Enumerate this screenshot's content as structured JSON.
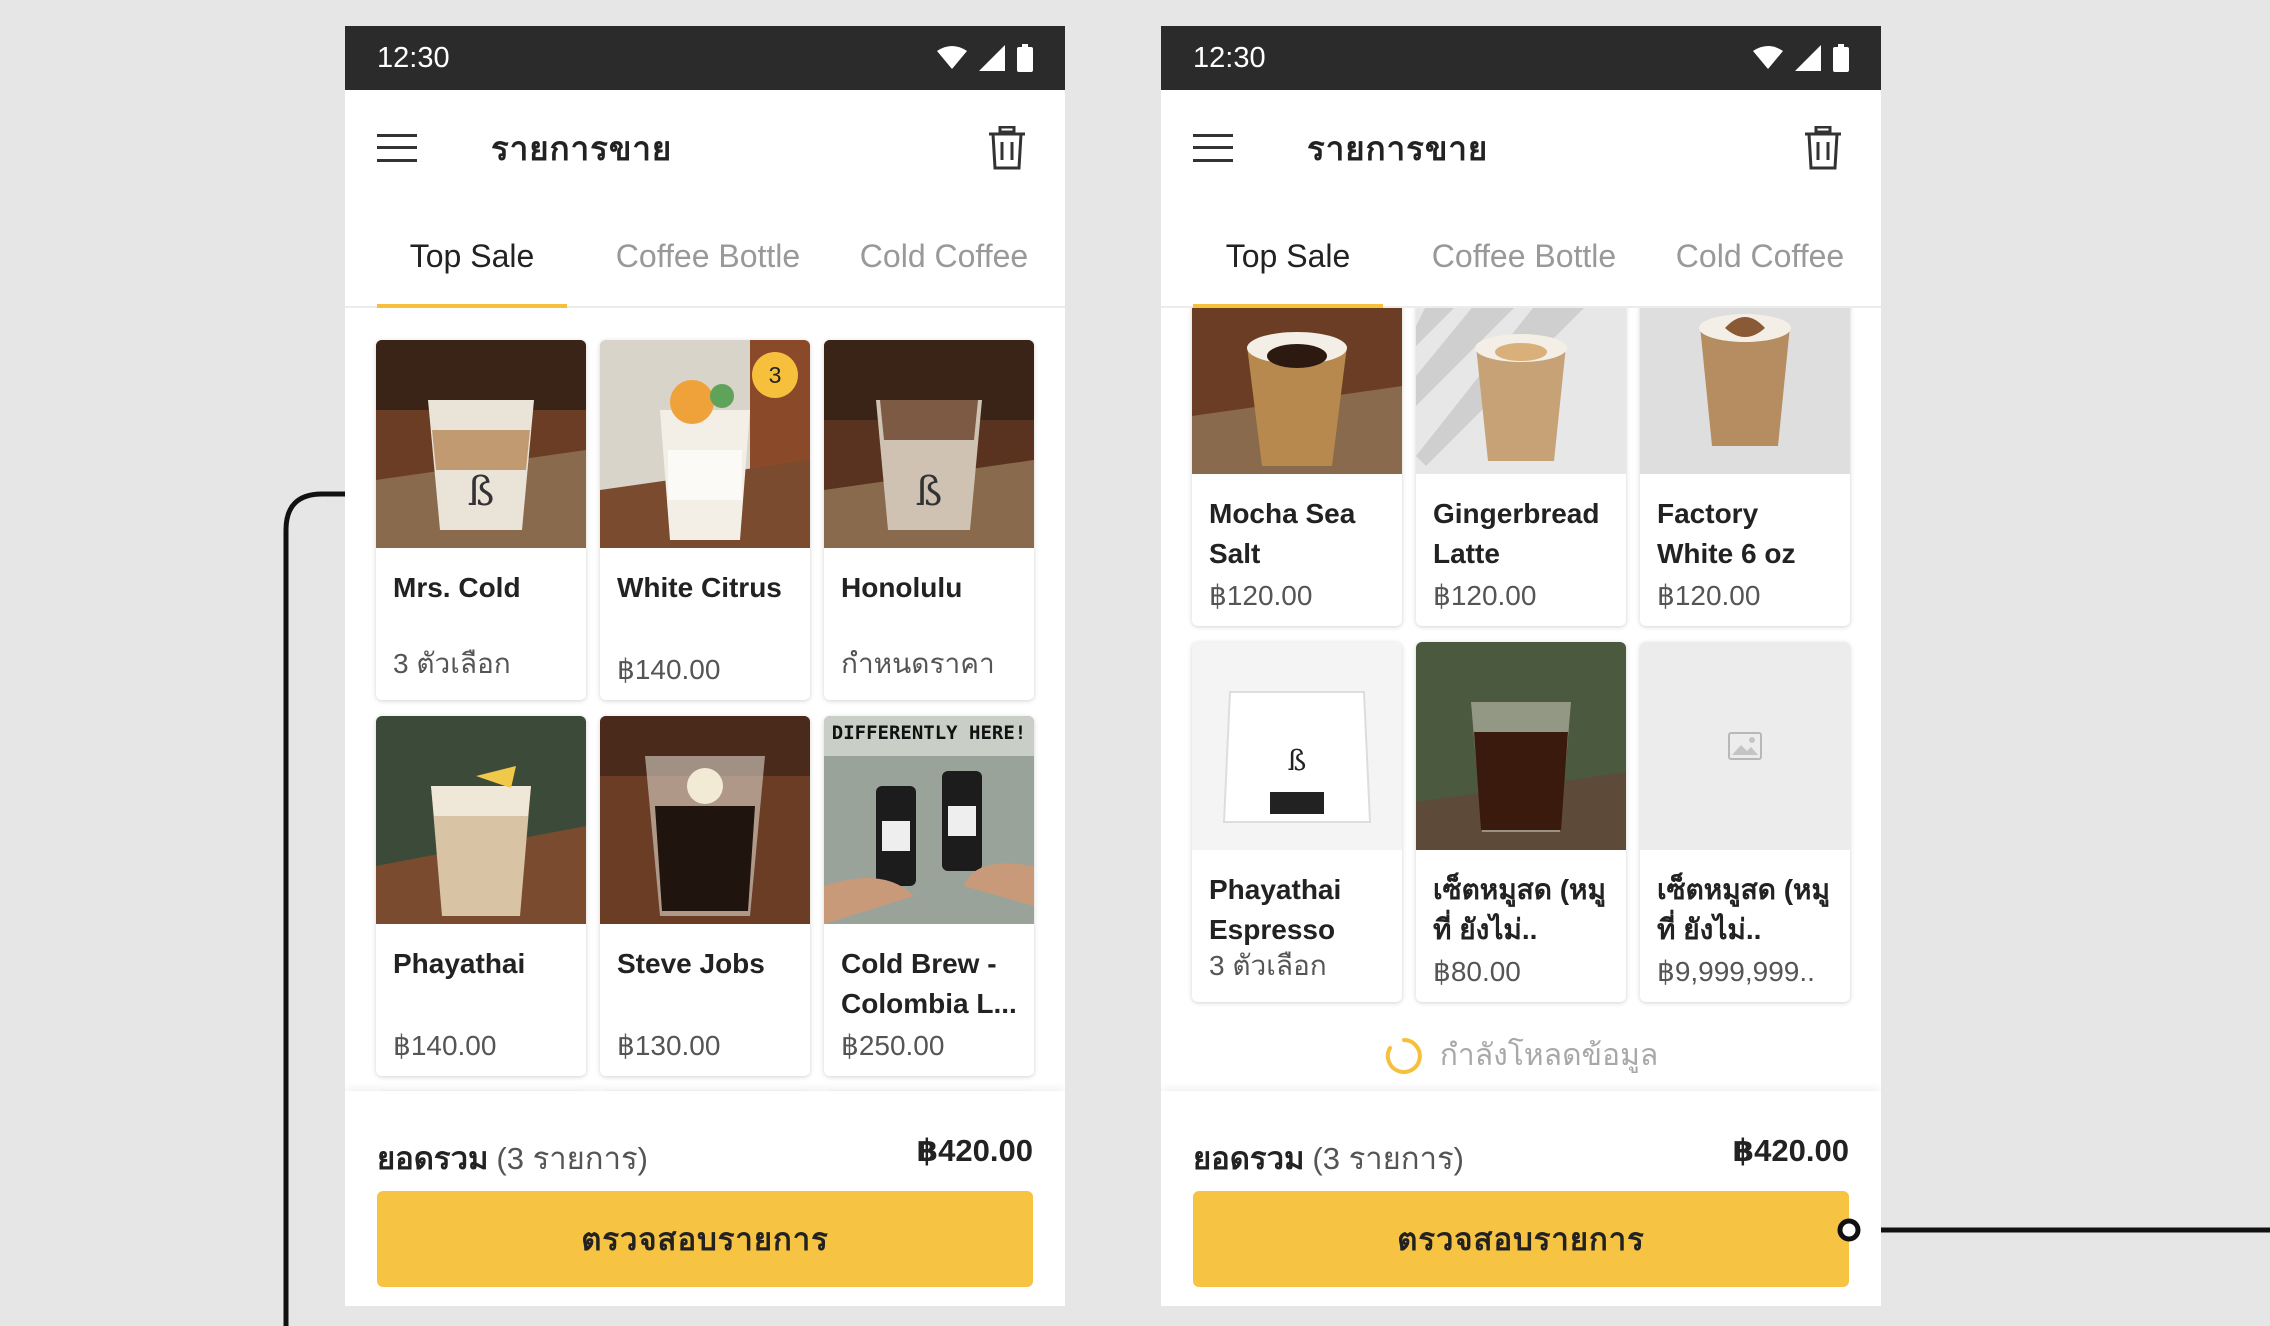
{
  "colors": {
    "accent": "#f6c03c",
    "statusbar": "#2b2b2b",
    "background": "#e6e6e6"
  },
  "screens": [
    {
      "status": {
        "time": "12:30"
      },
      "header": {
        "title": "รายการขาย",
        "menu_icon": "menu-icon",
        "trash_icon": "trash-icon"
      },
      "tabs": [
        "Top Sale",
        "Coffee Bottle",
        "Cold Coffee"
      ],
      "active_tab": 0,
      "products": [
        {
          "name": "Mrs. Cold",
          "price": "3 ตัวเลือก"
        },
        {
          "name": "White Citrus",
          "price": "฿140.00",
          "badge": "3"
        },
        {
          "name": "Honolulu",
          "price": "กำหนดราคา"
        },
        {
          "name": "Phayathai",
          "price": "฿140.00"
        },
        {
          "name": "Steve Jobs",
          "price": "฿130.00"
        },
        {
          "name": "Cold Brew - Colombia L...",
          "price": "฿250.00",
          "image_text": "DIFFERENTLY HERE!"
        }
      ],
      "footer": {
        "total_label": "ยอดรวม",
        "total_count": "(3 รายการ)",
        "total_value": "฿420.00",
        "checkout_label": "ตรวจสอบรายการ"
      }
    },
    {
      "status": {
        "time": "12:30"
      },
      "header": {
        "title": "รายการขาย",
        "menu_icon": "menu-icon",
        "trash_icon": "trash-icon"
      },
      "tabs": [
        "Top Sale",
        "Coffee Bottle",
        "Cold Coffee"
      ],
      "active_tab": 0,
      "products": [
        {
          "name": "Mocha Sea Salt",
          "price": "฿120.00"
        },
        {
          "name": "Gingerbread Latte",
          "price": "฿120.00"
        },
        {
          "name": "Factory White 6 oz",
          "price": "฿120.00"
        },
        {
          "name": "Phayathai Espresso",
          "price": "3 ตัวเลือก"
        },
        {
          "name": "เซ็ตหมูสด (หมูที่ ยังไม่..",
          "price": "฿80.00"
        },
        {
          "name": "เซ็ตหมูสด (หมูที่ ยังไม่..",
          "price": "฿9,999,999..",
          "placeholder_icon": "image-placeholder-icon"
        }
      ],
      "loading_text": "กำลังโหลดข้อมูล",
      "footer": {
        "total_label": "ยอดรวม",
        "total_count": "(3 รายการ)",
        "total_value": "฿420.00",
        "checkout_label": "ตรวจสอบรายการ"
      }
    }
  ]
}
